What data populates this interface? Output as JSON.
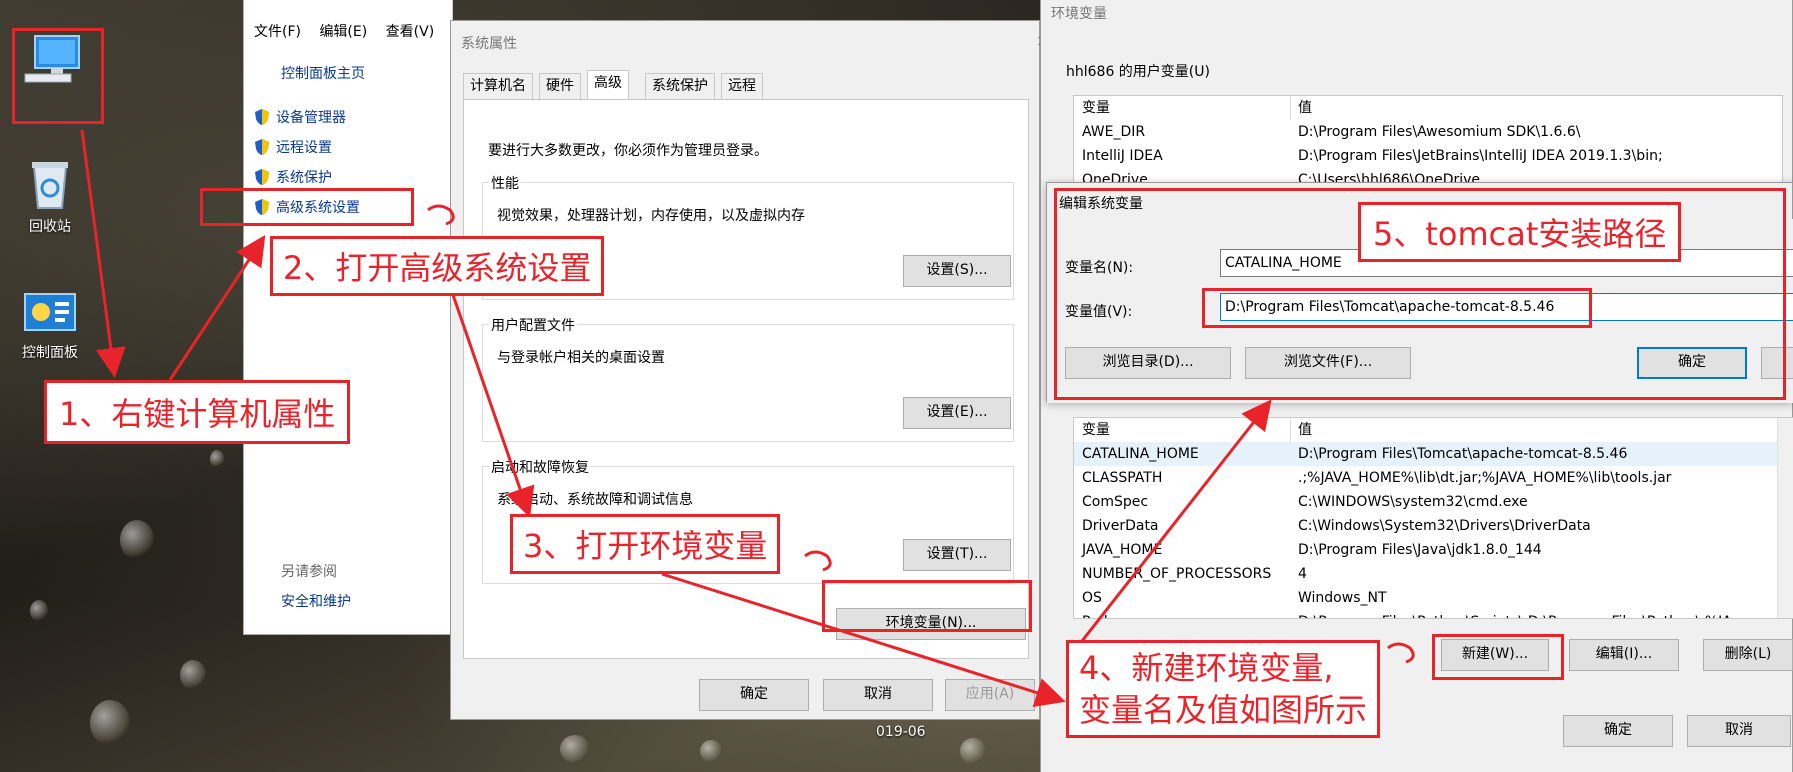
{
  "desktop": {
    "icons": [
      {
        "label": "",
        "icon": "computer-icon"
      },
      {
        "label": "回收站",
        "icon": "recycle-bin-icon"
      },
      {
        "label": "控制面板",
        "icon": "control-panel-icon"
      }
    ],
    "date_fragment": "019-06"
  },
  "control_panel": {
    "menu": [
      "文件(F)",
      "编辑(E)",
      "查看(V)"
    ],
    "home_link": "控制面板主页",
    "items": [
      "设备管理器",
      "远程设置",
      "系统保护",
      "高级系统设置"
    ],
    "see_also_title": "另请参阅",
    "see_also_link": "安全和维护"
  },
  "system_properties": {
    "title": "系统属性",
    "tabs": [
      "计算机名",
      "硬件",
      "高级",
      "系统保护",
      "远程"
    ],
    "active_tab": "高级",
    "admin_note": "要进行大多数更改，你必须作为管理员登录。",
    "performance": {
      "title": "性能",
      "desc": "视觉效果，处理器计划，内存使用，以及虚拟内存",
      "button": "设置(S)..."
    },
    "user_profile": {
      "title": "用户配置文件",
      "desc": "与登录帐户相关的桌面设置",
      "button": "设置(E)..."
    },
    "startup": {
      "title": "启动和故障恢复",
      "desc": "系统启动、系统故障和调试信息",
      "button": "设置(T)..."
    },
    "env_button": "环境变量(N)...",
    "ok": "确定",
    "cancel": "取消",
    "apply": "应用(A)"
  },
  "env_vars": {
    "title": "环境变量",
    "user_section_title": "hhl686 的用户变量(U)",
    "col_var": "变量",
    "col_value": "值",
    "user_rows": [
      {
        "name": "AWE_DIR",
        "value": "D:\\Program Files\\Awesomium SDK\\1.6.6\\"
      },
      {
        "name": "IntelliJ IDEA",
        "value": "D:\\Program Files\\JetBrains\\IntelliJ IDEA 2019.1.3\\bin;"
      },
      {
        "name": "OneDrive",
        "value": "C:\\Users\\hhl686\\OneDrive"
      }
    ],
    "system_rows": [
      {
        "name": "CATALINA_HOME",
        "value": "D:\\Program Files\\Tomcat\\apache-tomcat-8.5.46"
      },
      {
        "name": "CLASSPATH",
        "value": ".;%JAVA_HOME%\\lib\\dt.jar;%JAVA_HOME%\\lib\\tools.jar"
      },
      {
        "name": "ComSpec",
        "value": "C:\\WINDOWS\\system32\\cmd.exe"
      },
      {
        "name": "DriverData",
        "value": "C:\\Windows\\System32\\Drivers\\DriverData"
      },
      {
        "name": "JAVA_HOME",
        "value": "D:\\Program Files\\Java\\jdk1.8.0_144"
      },
      {
        "name": "NUMBER_OF_PROCESSORS",
        "value": "4"
      },
      {
        "name": "OS",
        "value": "Windows_NT"
      },
      {
        "name": "Path",
        "value": "D:\\Program Files\\Python\\Scripts\\;D:\\Program Files\\Python\\;%JA"
      }
    ],
    "new_button": "新建(W)...",
    "edit_button": "编辑(I)...",
    "delete_button": "删除(L)",
    "ok": "确定",
    "cancel": "取消"
  },
  "edit_dialog": {
    "title": "编辑系统变量",
    "name_label": "变量名(N):",
    "name_value": "CATALINA_HOME",
    "value_label": "变量值(V):",
    "value_value": "D:\\Program Files\\Tomcat\\apache-tomcat-8.5.46",
    "browse_dir": "浏览目录(D)...",
    "browse_file": "浏览文件(F)...",
    "ok": "确定"
  },
  "annotations": {
    "step1": "1、右键计算机属性",
    "step2": "2、打开高级系统设置",
    "step3": "3、打开环境变量",
    "step4_line1": "4、新建环境变量,",
    "step4_line2": "变量名及值如图所示",
    "step5": "5、tomcat安装路径",
    "color": "#e8232a"
  }
}
